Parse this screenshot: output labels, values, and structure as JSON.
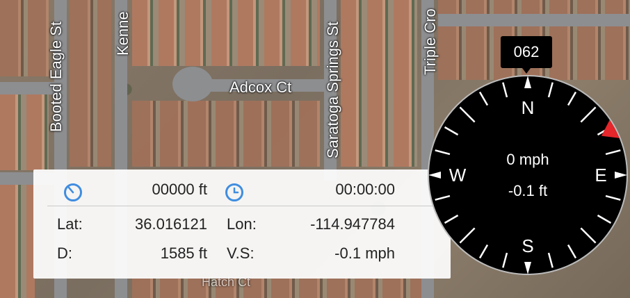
{
  "map": {
    "streets": {
      "booted_eagle": "Booted Eagle St",
      "kenneth": "Kenne",
      "adcox": "Adcox Ct",
      "saratoga": "Saratoga Springs St",
      "triple": "Triple Cro",
      "bottom_partial": "Hatch Ct"
    }
  },
  "info": {
    "distance_value": "00000 ft",
    "time_value": "00:00:00",
    "lat_label": "Lat:",
    "lat_value": "36.016121",
    "lon_label": "Lon:",
    "lon_value": "-114.947784",
    "d_label": "D:",
    "d_value": "1585 ft",
    "vs_label": "V.S:",
    "vs_value": "-0.1 mph",
    "icon_color": "#3f8de0"
  },
  "compass": {
    "heading": "062",
    "speed": "0 mph",
    "altitude": "-0.1 ft",
    "north": "N",
    "south": "S",
    "east": "E",
    "west": "W",
    "bearing_degrees": 62,
    "marker_color": "#e5262a"
  }
}
